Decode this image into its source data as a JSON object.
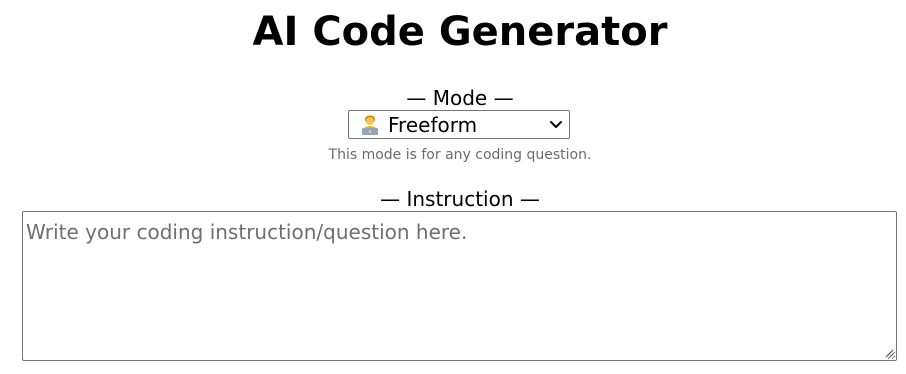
{
  "header": {
    "title": "AI Code Generator"
  },
  "mode": {
    "label": "— Mode —",
    "selected_icon": "technologist-emoji",
    "selected_value": "Freeform",
    "description": "This mode is for any coding question."
  },
  "instruction": {
    "label": "— Instruction —",
    "value": "",
    "placeholder": "Write your coding instruction/question here."
  }
}
